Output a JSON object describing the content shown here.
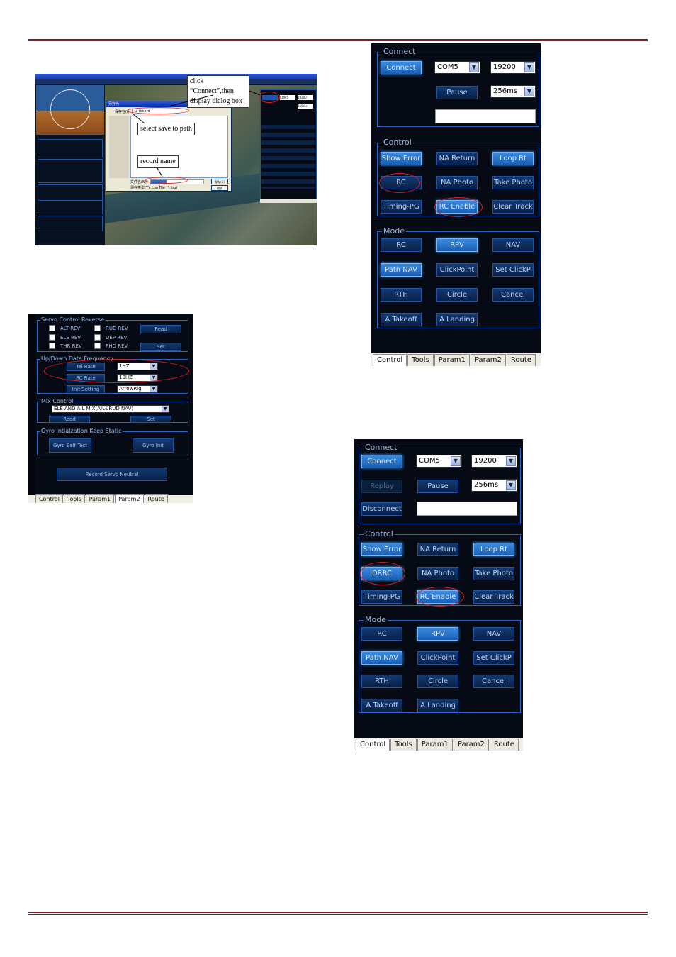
{
  "shot1": {
    "callout_connect": "click “Connect”,then display dialog box",
    "callout_path": "select save to path",
    "callout_name": "record name",
    "record_filename": "u_record",
    "file_label": "文件名(N):",
    "type_label": "保存类型(T):",
    "type_value": "Log File (*.log)",
    "save_button": "保存(S)",
    "cancel_button": "取消",
    "dialog_title": "另存为",
    "save_in_label": "保存在(I):",
    "port_value": "COM5",
    "baud_value": "19200",
    "interval_value": "256ms"
  },
  "param_panel": {
    "servo_group": "Servo Control Reverse",
    "alt_rev": "ALT REV",
    "rud_rev": "RUD REV",
    "ele_rev": "ELE REV",
    "dep_rev": "DEP REV",
    "thr_rev": "THR REV",
    "pho_rev": "PHO REV",
    "read": "Read",
    "set": "Set",
    "freq_group": "Up/Down Data Frequency",
    "tel_rate": "Tel Rate",
    "tel_rate_value": "1HZ",
    "rc_rate": "RC Rate",
    "rc_rate_value": "10HZ",
    "init_setting": "Init Setting",
    "init_value": "ArrowRig",
    "mix_group": "Mix Control",
    "mix_value": "ELE AND AIL MIX(AIL&RUD NAV)",
    "mix_read": "Read",
    "mix_set": "Set",
    "gyro_group": "Gyro Intialzation Keep Static",
    "gyro_self_test": "Gyro Self Test",
    "gyro_init": "Gyro Init",
    "record_servo": "Record Servo Neutral",
    "tabs": [
      "Control",
      "Tools",
      "Param1",
      "Param2",
      "Route"
    ]
  },
  "panel_a": {
    "connect_group": "Connect",
    "connect": "Connect",
    "port": "COM5",
    "baud": "19200",
    "pause": "Pause",
    "interval": "256ms",
    "control_group": "Control",
    "show_error": "Show Error",
    "na_return": "NA Return",
    "loop_rt": "Loop Rt",
    "rc": "RC",
    "na_photo": "NA Photo",
    "take_photo": "Take Photo",
    "timing_pg": "Timing-PG",
    "rc_enable": "RC Enable",
    "clear_track": "Clear Track",
    "mode_group": "Mode",
    "mode_rc": "RC",
    "mode_rpv": "RPV",
    "mode_nav": "NAV",
    "path_nav": "Path NAV",
    "clickpoint": "ClickPoint",
    "set_clickp": "Set ClickP",
    "rth": "RTH",
    "circle": "Circle",
    "cancel": "Cancel",
    "a_takeoff": "A Takeoff",
    "a_landing": "A Landing",
    "tabs": [
      "Control",
      "Tools",
      "Param1",
      "Param2",
      "Route"
    ]
  },
  "panel_b": {
    "connect_group": "Connect",
    "connect": "Connect",
    "port": "COM5",
    "baud": "19200",
    "replay": "Replay",
    "pause": "Pause",
    "interval": "256ms",
    "disconnect": "Disconnect",
    "control_group": "Control",
    "show_error": "Show Error",
    "na_return": "NA Return",
    "loop_rt": "Loop Rt",
    "drrc": "DRRC",
    "na_photo": "NA Photo",
    "take_photo": "Take Photo",
    "timing_pg": "Timing-PG",
    "rc_enable": "RC Enable",
    "clear_track": "Clear Track",
    "mode_group": "Mode",
    "mode_rc": "RC",
    "mode_rpv": "RPV",
    "mode_nav": "NAV",
    "path_nav": "Path NAV",
    "clickpoint": "ClickPoint",
    "set_clickp": "Set ClickP",
    "rth": "RTH",
    "circle": "Circle",
    "cancel": "Cancel",
    "a_takeoff": "A Takeoff",
    "a_landing": "A Landing",
    "tabs": [
      "Control",
      "Tools",
      "Param1",
      "Param2",
      "Route"
    ]
  }
}
